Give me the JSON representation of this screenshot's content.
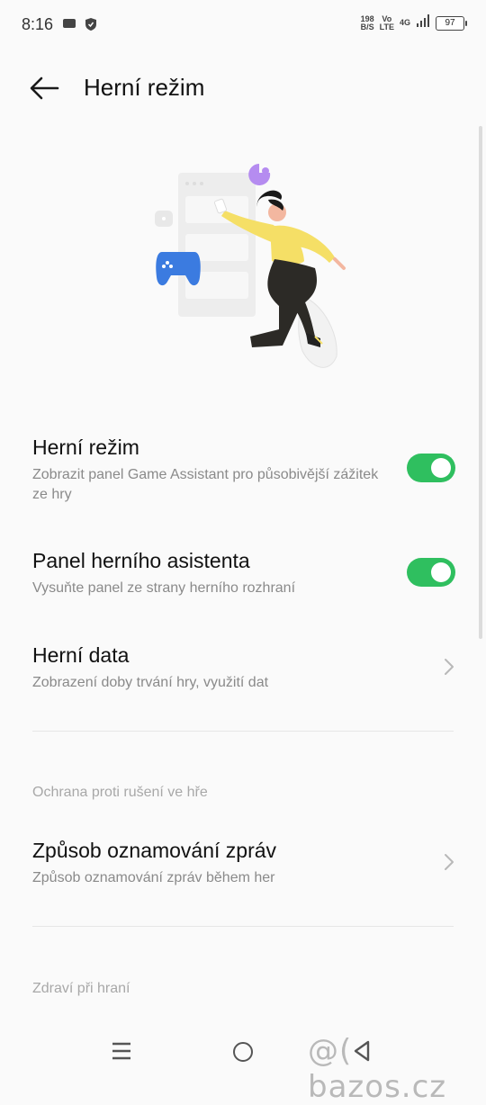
{
  "status_bar": {
    "time": "8:16",
    "net_speed_top": "198",
    "net_speed_bottom": "B/S",
    "volte_top": "Vo",
    "volte_bottom": "LTE",
    "network": "4G",
    "battery": "97"
  },
  "header": {
    "title": "Herní režim"
  },
  "settings": {
    "game_mode": {
      "title": "Herní režim",
      "subtitle": "Zobrazit panel Game Assistant pro působivější zážitek ze hry",
      "enabled": true
    },
    "assistant_panel": {
      "title": "Panel herního asistenta",
      "subtitle": "Vysuňte panel ze strany herního rozhraní",
      "enabled": true
    },
    "game_data": {
      "title": "Herní data",
      "subtitle": "Zobrazení doby trvání hry, využití dat"
    },
    "section_dnd": "Ochrana proti rušení ve hře",
    "notification_mode": {
      "title": "Způsob oznamování zpráv",
      "subtitle": "Způsob oznamování zpráv během her"
    },
    "section_health": "Zdraví při hraní"
  },
  "watermark": "@( bazos.cz",
  "colors": {
    "toggle_on": "#2fbf5f",
    "background": "#fafafa"
  }
}
